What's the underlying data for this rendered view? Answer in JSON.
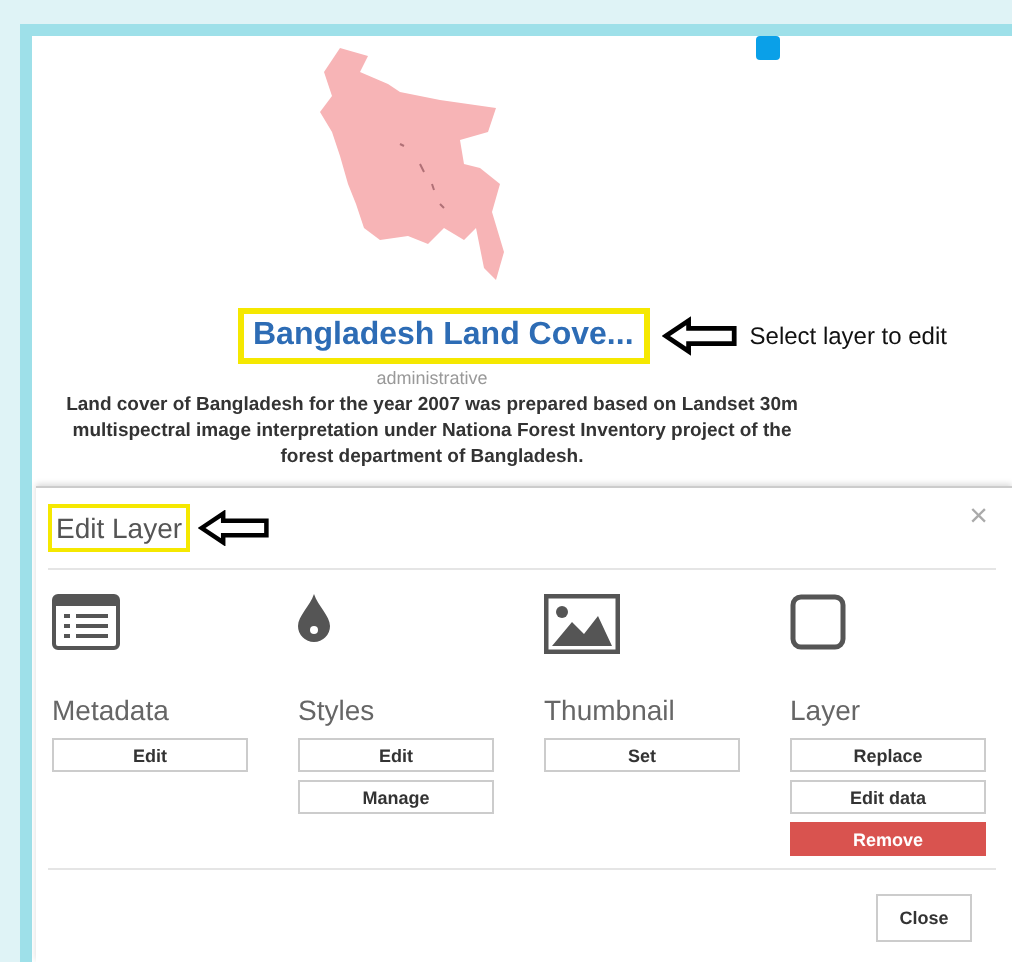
{
  "layer": {
    "title": "Bangladesh Land Cove...",
    "title_highlighted": true,
    "category": "administrative",
    "description": "Land cover of Bangladesh for the year 2007 was prepared based on Landset 30m multispectral image interpretation under Nationa Forest Inventory project of the forest department of Bangladesh."
  },
  "title_callout": "Select layer to edit",
  "modal": {
    "title": "Edit Layer",
    "title_highlighted": true,
    "close_glyph": "×",
    "sections": [
      {
        "label": "Metadata",
        "kind": "list",
        "buttons": [
          {
            "label": "Edit",
            "kind": "default"
          }
        ]
      },
      {
        "label": "Styles",
        "kind": "drop",
        "buttons": [
          {
            "label": "Edit",
            "kind": "default"
          },
          {
            "label": "Manage",
            "kind": "default"
          }
        ]
      },
      {
        "label": "Thumbnail",
        "kind": "image",
        "buttons": [
          {
            "label": "Set",
            "kind": "default"
          }
        ]
      },
      {
        "label": "Layer",
        "kind": "square",
        "buttons": [
          {
            "label": "Replace",
            "kind": "default"
          },
          {
            "label": "Edit data",
            "kind": "default"
          },
          {
            "label": "Remove",
            "kind": "danger"
          }
        ]
      }
    ],
    "footer_button": "Close"
  }
}
